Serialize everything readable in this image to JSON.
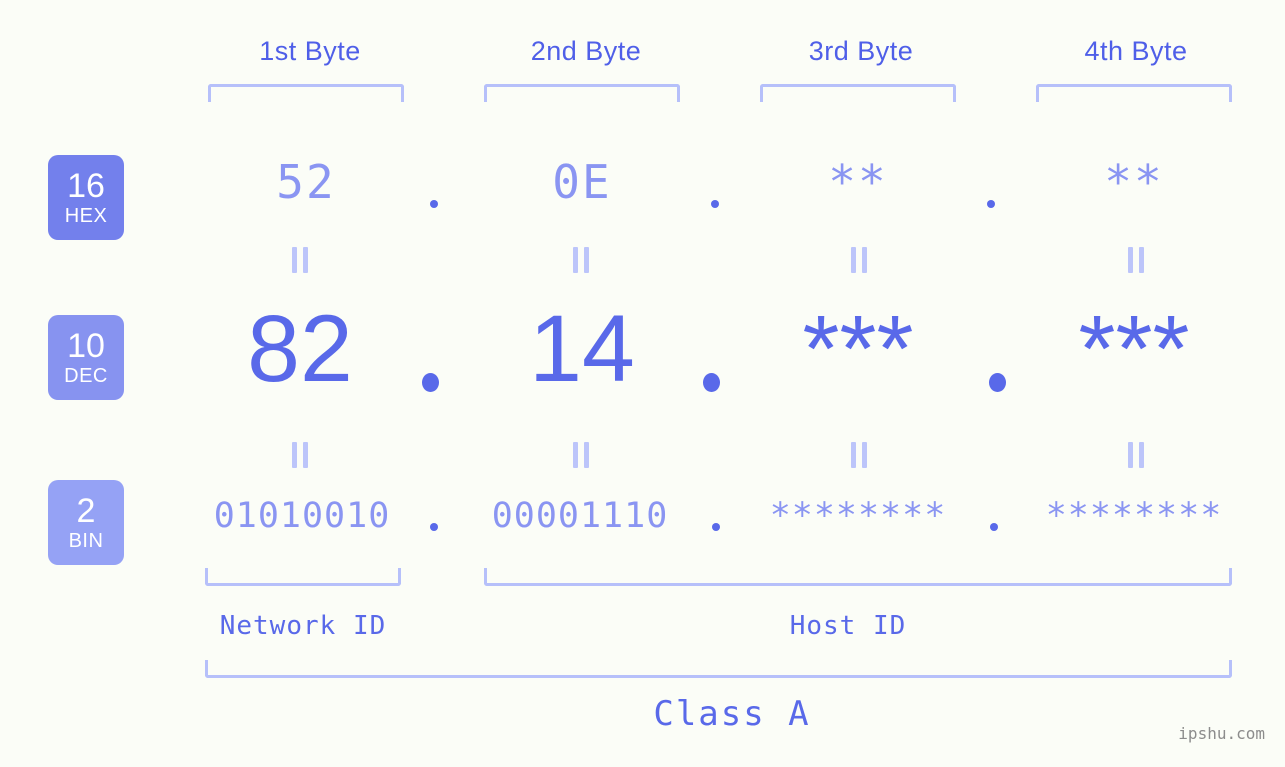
{
  "theme": {
    "background": "#fbfdf7",
    "accent_strong": "#5969e9",
    "accent_mid": "#8a95f2",
    "accent_light": "#b6c0fa",
    "badge_hex": "#7380ec",
    "badge_dec": "#8793f0",
    "badge_bin": "#95a2f5"
  },
  "byte_headings": [
    {
      "label": "1st Byte"
    },
    {
      "label": "2nd Byte"
    },
    {
      "label": "3rd Byte"
    },
    {
      "label": "4th Byte"
    }
  ],
  "bases": [
    {
      "num": "16",
      "abbr": "HEX"
    },
    {
      "num": "10",
      "abbr": "DEC"
    },
    {
      "num": "2",
      "abbr": "BIN"
    }
  ],
  "rows": {
    "hex": {
      "base": "16",
      "name": "HEX",
      "values": [
        "52",
        "0E",
        "**",
        "**"
      ],
      "separator": "."
    },
    "dec": {
      "base": "10",
      "name": "DEC",
      "values": [
        "82",
        "14",
        "***",
        "***"
      ],
      "separator": "."
    },
    "bin": {
      "base": "2",
      "name": "BIN",
      "values": [
        "01010010",
        "00001110",
        "********",
        "********"
      ],
      "separator": "."
    }
  },
  "equals_symbol": "||",
  "segments": {
    "network_id": "Network ID",
    "host_id": "Host ID"
  },
  "class_label": "Class A",
  "watermark": "ipshu.com"
}
